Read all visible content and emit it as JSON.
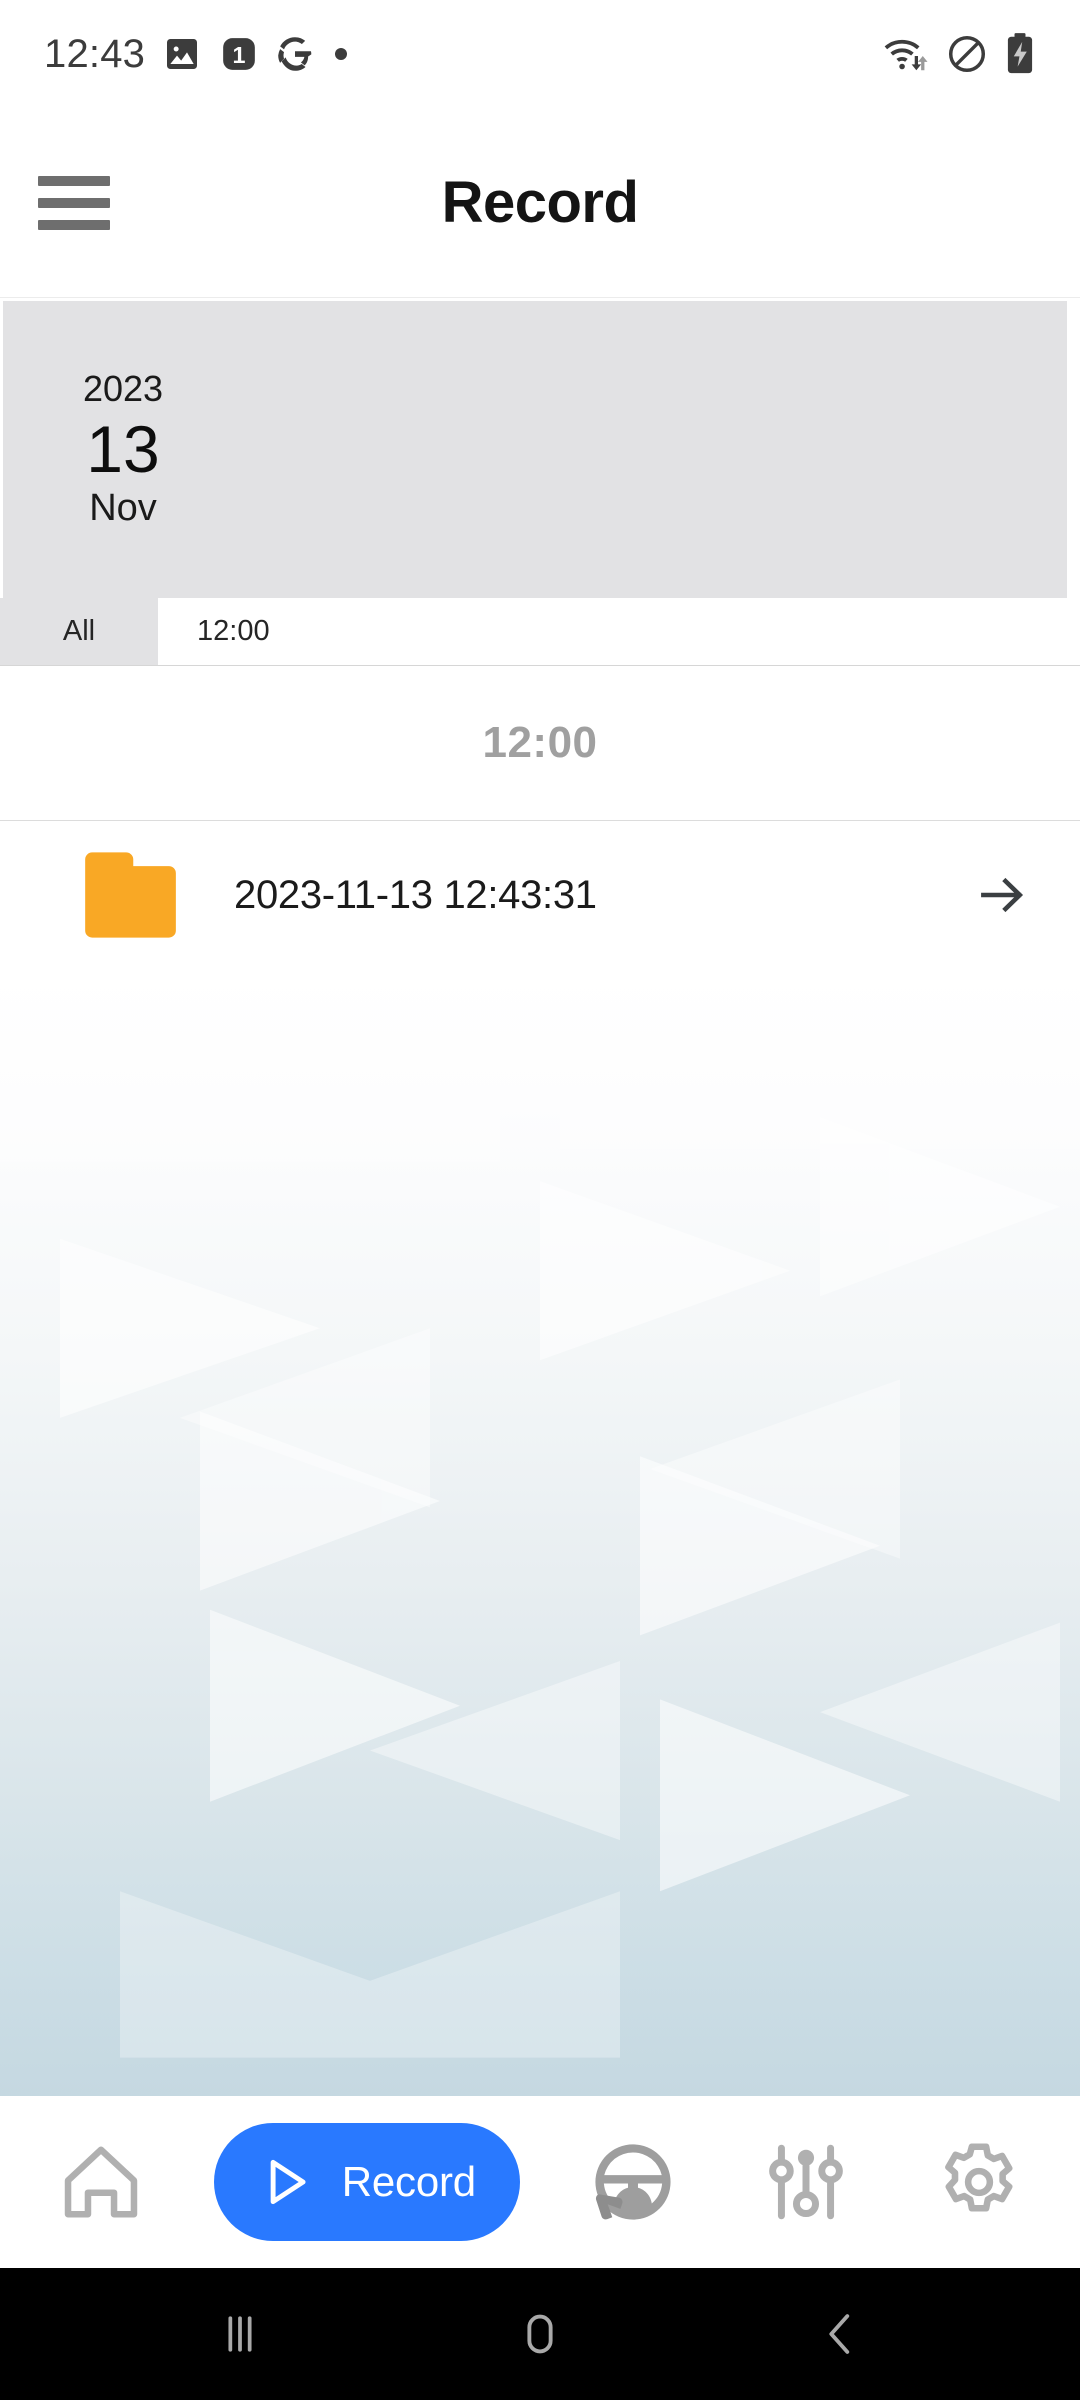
{
  "status_bar": {
    "clock": "12:43",
    "left_icons": [
      "gallery-icon",
      "notification-count-1-icon",
      "google-g-icon",
      "dot-icon"
    ],
    "notification_count": "1",
    "right_icons": [
      "wifi-transfer-icon",
      "do-not-disturb-icon",
      "battery-charging-icon"
    ]
  },
  "app_bar": {
    "menu_icon": "hamburger-menu-icon",
    "title": "Record"
  },
  "date_card": {
    "year": "2023",
    "day": "13",
    "month": "Nov",
    "background_color": "#E2E2E4"
  },
  "tabs": [
    {
      "label": "All",
      "selected": true
    },
    {
      "label": "12:00",
      "selected": false
    }
  ],
  "list": {
    "section_header": "12:00",
    "rows": [
      {
        "icon": "folder-icon",
        "icon_color": "#F9A825",
        "title": "2023-11-13 12:43:31",
        "chevron": "arrow-right-icon"
      }
    ]
  },
  "bottom_nav": {
    "accent_color": "#2979FF",
    "items": [
      {
        "id": "home",
        "icon": "home-icon",
        "label": "",
        "active": false
      },
      {
        "id": "record",
        "icon": "play-triangle-icon",
        "label": "Record",
        "active": true
      },
      {
        "id": "driving",
        "icon": "steering-wheel-icon",
        "label": "",
        "active": false
      },
      {
        "id": "adjust",
        "icon": "sliders-icon",
        "label": "",
        "active": false
      },
      {
        "id": "settings",
        "icon": "gear-icon",
        "label": "",
        "active": false
      }
    ]
  },
  "android_nav": {
    "items": [
      {
        "id": "recents",
        "icon": "recents-bars-icon"
      },
      {
        "id": "home",
        "icon": "home-pill-icon"
      },
      {
        "id": "back",
        "icon": "back-chevron-icon"
      }
    ]
  }
}
